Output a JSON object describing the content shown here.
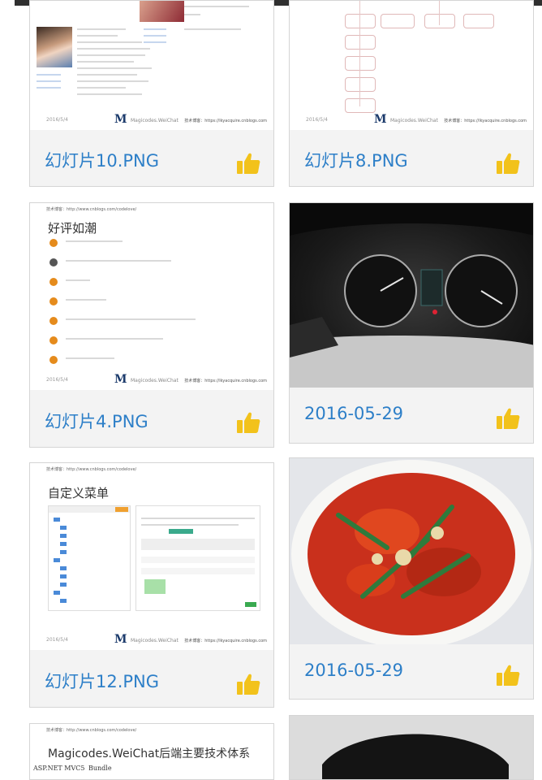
{
  "cards": [
    {
      "caption": "幻灯片10.PNG",
      "slide": {
        "date": "2016/5/4",
        "logo": "M",
        "brand": "Magicodes.WeiChat",
        "blog": "技术博客：https://lkyacquire.cnblogs.com"
      }
    },
    {
      "caption": "幻灯片8.PNG",
      "slide": {
        "date": "2016/5/4",
        "logo": "M",
        "brand": "Magicodes.WeiChat",
        "blog": "技术博客：https://lkyacquire.cnblogs.com"
      }
    },
    {
      "caption": "幻灯片4.PNG",
      "slide": {
        "url": "技术博客：http://www.cnblogs.com/codelove/",
        "title": "好评如潮",
        "date": "2016/5/4",
        "logo": "M",
        "brand": "Magicodes.WeiChat",
        "blog": "技术博客：https://lkyacquire.cnblogs.com"
      }
    },
    {
      "caption": "2016-05-29"
    },
    {
      "caption": "幻灯片12.PNG",
      "slide": {
        "url": "技术博客：http://www.cnblogs.com/codelove/",
        "title": "自定义菜单",
        "date": "2016/5/4",
        "logo": "M",
        "brand": "Magicodes.WeiChat",
        "blog": "技术博客：https://lkyacquire.cnblogs.com"
      }
    },
    {
      "caption": "2016-05-29"
    },
    {
      "slide": {
        "url": "技术博客：http://www.cnblogs.com/codelove/",
        "title": "Magicodes.WeiChat后端主要技术体系",
        "footnote1": "ASP.NET MVC5",
        "footnote2": "Bundle"
      }
    }
  ],
  "icons": {
    "like": "thumbs-up-icon"
  },
  "colors": {
    "caption": "#2d7fc8",
    "like": "#f2c21b",
    "cardBg": "#f3f3f3"
  }
}
